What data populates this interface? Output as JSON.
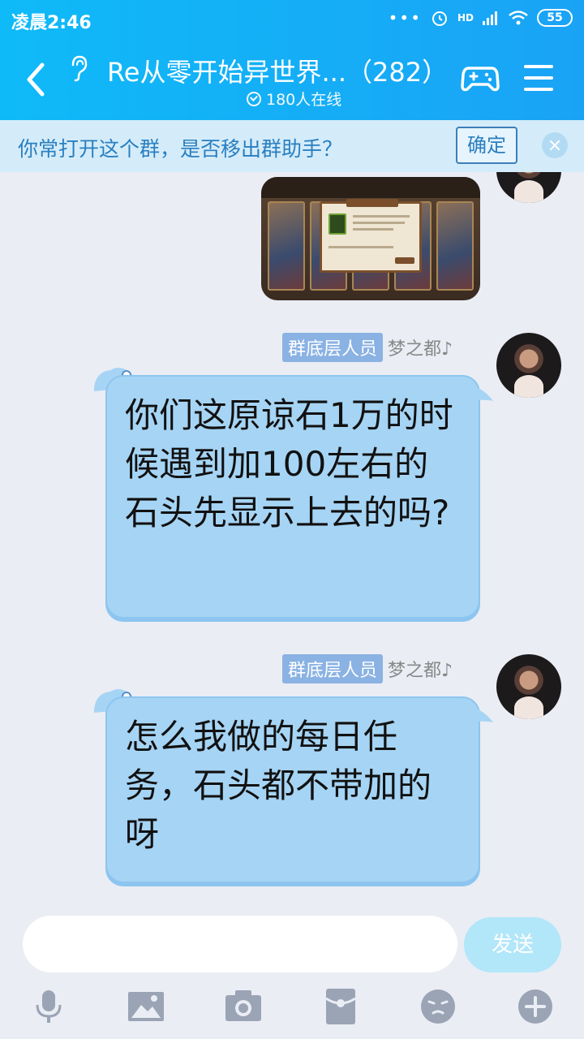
{
  "status": {
    "time": "凌晨2:46",
    "signal": "HD",
    "battery": "55"
  },
  "header": {
    "title": "Re从零开始异世界...（282）",
    "online": "180人在线"
  },
  "notice": {
    "text": "你常打开这个群，是否移出群助手？",
    "confirm": "确定"
  },
  "messages": [
    {
      "type": "image",
      "caption": ""
    },
    {
      "type": "text",
      "role": "群底层人员",
      "nick": "梦之都♪",
      "text": "你们这原谅石1万的时候遇到加100左右的石头先显示上去的吗?"
    },
    {
      "type": "text",
      "role": "群底层人员",
      "nick": "梦之都♪",
      "text": "怎么我做的每日任务，石头都不带加的呀"
    }
  ],
  "input": {
    "placeholder": "",
    "send": "发送"
  },
  "toolbar": [
    "mic-icon",
    "image-icon",
    "camera-icon",
    "red-packet-icon",
    "emoji-icon",
    "plus-icon"
  ],
  "colors": {
    "header": "#1aa3f5",
    "bubble": "#a6d4f4",
    "badge": "#8ab2e3"
  }
}
